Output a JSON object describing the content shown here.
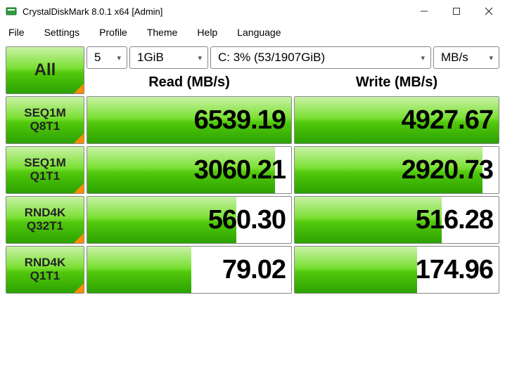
{
  "window": {
    "title": "CrystalDiskMark 8.0.1 x64 [Admin]"
  },
  "menu": {
    "file": "File",
    "settings": "Settings",
    "profile": "Profile",
    "theme": "Theme",
    "help": "Help",
    "language": "Language"
  },
  "controls": {
    "all_label": "All",
    "runs": "5",
    "size": "1GiB",
    "drive": "C: 3% (53/1907GiB)",
    "unit": "MB/s"
  },
  "headers": {
    "read": "Read (MB/s)",
    "write": "Write (MB/s)"
  },
  "tests": [
    {
      "label1": "SEQ1M",
      "label2": "Q8T1",
      "read": "6539.19",
      "write": "4927.67",
      "read_pct": 100,
      "write_pct": 100
    },
    {
      "label1": "SEQ1M",
      "label2": "Q1T1",
      "read": "3060.21",
      "write": "2920.73",
      "read_pct": 92,
      "write_pct": 92
    },
    {
      "label1": "RND4K",
      "label2": "Q32T1",
      "read": "560.30",
      "write": "516.28",
      "read_pct": 73,
      "write_pct": 72
    },
    {
      "label1": "RND4K",
      "label2": "Q1T1",
      "read": "79.02",
      "write": "174.96",
      "read_pct": 51,
      "write_pct": 60
    }
  ],
  "chart_data": {
    "type": "bar",
    "title": "CrystalDiskMark 8.0.1 benchmark",
    "unit": "MB/s",
    "categories": [
      "SEQ1M Q8T1",
      "SEQ1M Q1T1",
      "RND4K Q32T1",
      "RND4K Q1T1"
    ],
    "series": [
      {
        "name": "Read",
        "values": [
          6539.19,
          3060.21,
          560.3,
          79.02
        ]
      },
      {
        "name": "Write",
        "values": [
          4927.67,
          2920.73,
          516.28,
          174.96
        ]
      }
    ]
  }
}
